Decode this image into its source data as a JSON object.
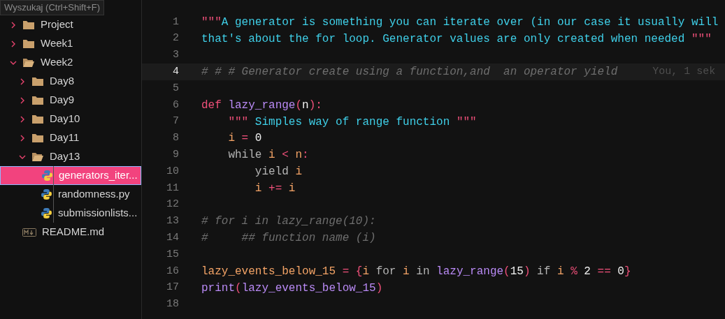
{
  "tooltip": {
    "text": "Wyszukaj (Ctrl+Shift+F)"
  },
  "explorer": {
    "items": [
      {
        "label": "Project",
        "kind": "folder",
        "expanded": false,
        "selected": false
      },
      {
        "label": "Week1",
        "kind": "folder",
        "expanded": false,
        "selected": false
      },
      {
        "label": "Week2",
        "kind": "folder",
        "expanded": true,
        "selected": false,
        "children": [
          {
            "label": "Day8",
            "kind": "folder",
            "expanded": false,
            "selected": false
          },
          {
            "label": "Day9",
            "kind": "folder",
            "expanded": false,
            "selected": false
          },
          {
            "label": "Day10",
            "kind": "folder",
            "expanded": false,
            "selected": false
          },
          {
            "label": "Day11",
            "kind": "folder",
            "expanded": false,
            "selected": false
          },
          {
            "label": "Day13",
            "kind": "folder",
            "expanded": true,
            "selected": false,
            "children": [
              {
                "label": "generators_iter...",
                "kind": "python",
                "selected": true
              },
              {
                "label": "randomness.py",
                "kind": "python",
                "selected": false
              },
              {
                "label": "submissionlists...",
                "kind": "python",
                "selected": false
              }
            ]
          }
        ]
      },
      {
        "label": "README.md",
        "kind": "markdown",
        "selected": false
      }
    ]
  },
  "editor": {
    "lines": [
      {
        "number": "1",
        "current": false,
        "tokens": [
          {
            "kind": "quote",
            "t": "\"\"\""
          },
          {
            "kind": "string",
            "t": "A generator is something you can iterate over (in our case it usually will"
          }
        ]
      },
      {
        "number": "2",
        "current": false,
        "tokens": [
          {
            "kind": "string",
            "t": "that's about the for loop. Generator values are only created when needed "
          },
          {
            "kind": "quote",
            "t": "\"\"\""
          }
        ]
      },
      {
        "number": "3",
        "current": false
      },
      {
        "number": "4",
        "current": true,
        "tokens": [
          {
            "kind": "comment",
            "t": "# # # Generator create using a function,and  an operator yield"
          }
        ],
        "blame": "You, 1 sek"
      },
      {
        "number": "5",
        "current": false
      },
      {
        "number": "6",
        "current": false,
        "tokens": [
          {
            "kind": "keyword",
            "t": "def"
          },
          {
            "kind": "function",
            "t": " lazy_range"
          },
          {
            "kind": "operator",
            "t": "("
          },
          {
            "kind": "param",
            "t": "n"
          },
          {
            "kind": "operator",
            "t": "):"
          }
        ]
      },
      {
        "number": "7",
        "current": false,
        "tokens": [
          {
            "kind": "quote",
            "t": "    \"\"\""
          },
          {
            "kind": "string",
            "t": " Simples way of range function "
          },
          {
            "kind": "quote",
            "t": "\"\"\""
          }
        ]
      },
      {
        "number": "8",
        "current": false,
        "tokens": [
          {
            "kind": "variable",
            "t": "    i"
          },
          {
            "kind": "operator",
            "t": " = "
          },
          {
            "kind": "param",
            "t": "0"
          }
        ]
      },
      {
        "number": "9",
        "current": false,
        "tokens": [
          {
            "kind": "plain",
            "t": "    while "
          },
          {
            "kind": "variable",
            "t": "i"
          },
          {
            "kind": "operator",
            "t": " < "
          },
          {
            "kind": "variable",
            "t": "n"
          },
          {
            "kind": "operator",
            "t": ":"
          }
        ]
      },
      {
        "number": "10",
        "current": false,
        "tokens": [
          {
            "kind": "plain",
            "t": "        yield "
          },
          {
            "kind": "variable",
            "t": "i"
          }
        ]
      },
      {
        "number": "11",
        "current": false,
        "tokens": [
          {
            "kind": "variable",
            "t": "        i"
          },
          {
            "kind": "operator",
            "t": " += "
          },
          {
            "kind": "variable",
            "t": "i"
          }
        ]
      },
      {
        "number": "12",
        "current": false
      },
      {
        "number": "13",
        "current": false,
        "tokens": [
          {
            "kind": "comment",
            "t": "# for i in lazy_range(10):"
          }
        ]
      },
      {
        "number": "14",
        "current": false,
        "tokens": [
          {
            "kind": "comment",
            "t": "#     ## function name (i)"
          }
        ]
      },
      {
        "number": "15",
        "current": false
      },
      {
        "number": "16",
        "current": false,
        "tokens": [
          {
            "kind": "variable",
            "t": "lazy_events_below_15"
          },
          {
            "kind": "operator",
            "t": " = {"
          },
          {
            "kind": "variable",
            "t": "i"
          },
          {
            "kind": "plain",
            "t": " for "
          },
          {
            "kind": "variable",
            "t": "i"
          },
          {
            "kind": "plain",
            "t": " in "
          },
          {
            "kind": "function",
            "t": "lazy_range"
          },
          {
            "kind": "operator",
            "t": "("
          },
          {
            "kind": "param",
            "t": "15"
          },
          {
            "kind": "operator",
            "t": ")"
          },
          {
            "kind": "plain",
            "t": " if "
          },
          {
            "kind": "variable",
            "t": "i"
          },
          {
            "kind": "operator",
            "t": " % "
          },
          {
            "kind": "param",
            "t": "2"
          },
          {
            "kind": "operator",
            "t": " == "
          },
          {
            "kind": "param",
            "t": "0"
          },
          {
            "kind": "operator",
            "t": "}"
          }
        ]
      },
      {
        "number": "17",
        "current": false,
        "tokens": [
          {
            "kind": "function",
            "t": "print"
          },
          {
            "kind": "operator",
            "t": "("
          },
          {
            "kind": "function",
            "t": "lazy_events_below_15"
          },
          {
            "kind": "operator",
            "t": ")"
          }
        ]
      },
      {
        "number": "18",
        "current": false
      }
    ]
  }
}
